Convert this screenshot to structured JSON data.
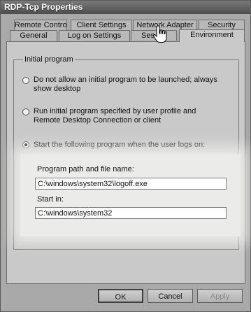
{
  "window": {
    "title": "RDP-Tcp Properties"
  },
  "tabs": {
    "back_row": [
      "Remote Control",
      "Client Settings",
      "Network Adapter",
      "Security"
    ],
    "front_row": [
      "General",
      "Log on Settings",
      "Ses",
      "Environment"
    ],
    "active": "Environment"
  },
  "initial_program": {
    "group_label": "Initial program",
    "options": [
      "Do not allow an initial program to be launched; always show desktop",
      "Run initial program specified by user profile and Remote Desktop Connection or client",
      "Start the following program when the user logs on:"
    ],
    "selected_index": 2,
    "program_path_label": "Program path and file name:",
    "program_path_value": "C:\\windows\\system32\\logoff.exe",
    "start_in_label": "Start in:",
    "start_in_value": "C:\\windows\\system32"
  },
  "buttons": {
    "ok": "OK",
    "cancel": "Cancel",
    "apply": "Apply"
  },
  "icons": {
    "cursor": "hand-pointer-icon"
  }
}
